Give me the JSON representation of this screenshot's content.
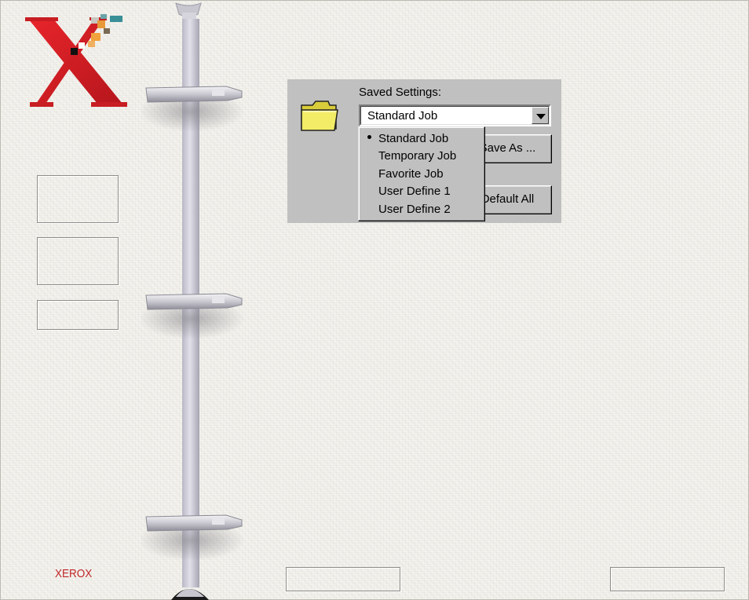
{
  "brand": {
    "logo_icon": "xerox-x-logo-icon",
    "wordmark": "XEROX",
    "brand_color": "#c0282a"
  },
  "settings_panel": {
    "folder_icon": "folder-icon",
    "saved_settings_label": "Saved Settings:",
    "selected_value": "Standard Job",
    "dropdown_arrow_icon": "chevron-down-icon",
    "save_as_label": "Save As ...",
    "default_all_label": "Default All",
    "options": [
      "Standard Job",
      "Temporary Job",
      "Favorite Job",
      "User Define 1",
      "User Define 2"
    ],
    "panel_color": "#c0c0c0"
  },
  "decorations": {
    "pole_icon": "pole-with-shelves-graphic"
  }
}
